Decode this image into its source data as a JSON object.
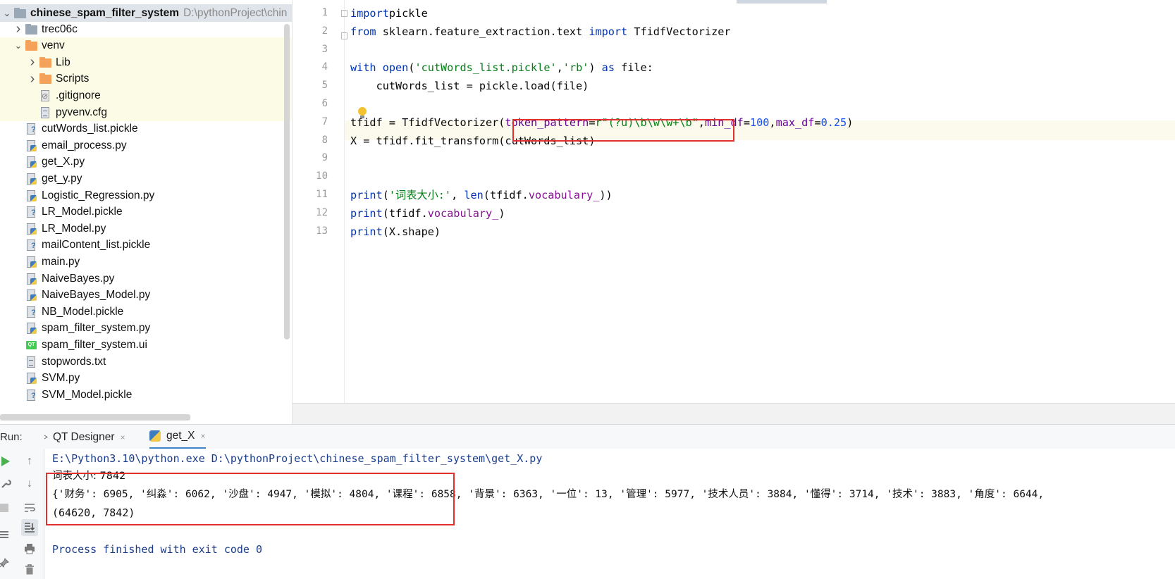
{
  "project_tree": {
    "root": {
      "name": "chinese_spam_filter_system",
      "path": "D:\\pythonProject\\chin"
    },
    "items": [
      {
        "label": "trec06c",
        "type": "folder-grey",
        "depth": 1,
        "chevron": "right"
      },
      {
        "label": "venv",
        "type": "folder-orange",
        "depth": 1,
        "chevron": "down"
      },
      {
        "label": "Lib",
        "type": "folder-orange",
        "depth": 2,
        "chevron": "right"
      },
      {
        "label": "Scripts",
        "type": "folder-orange",
        "depth": 2,
        "chevron": "right"
      },
      {
        "label": ".gitignore",
        "type": "gitignore",
        "depth": 2,
        "chevron": ""
      },
      {
        "label": "pyvenv.cfg",
        "type": "text",
        "depth": 2,
        "chevron": ""
      },
      {
        "label": "cutWords_list.pickle",
        "type": "pickle",
        "depth": 1,
        "chevron": ""
      },
      {
        "label": "email_process.py",
        "type": "python",
        "depth": 1,
        "chevron": ""
      },
      {
        "label": "get_X.py",
        "type": "python",
        "depth": 1,
        "chevron": ""
      },
      {
        "label": "get_y.py",
        "type": "python",
        "depth": 1,
        "chevron": ""
      },
      {
        "label": "Logistic_Regression.py",
        "type": "python",
        "depth": 1,
        "chevron": ""
      },
      {
        "label": "LR_Model.pickle",
        "type": "pickle",
        "depth": 1,
        "chevron": ""
      },
      {
        "label": "LR_Model.py",
        "type": "python",
        "depth": 1,
        "chevron": ""
      },
      {
        "label": "mailContent_list.pickle",
        "type": "pickle",
        "depth": 1,
        "chevron": ""
      },
      {
        "label": "main.py",
        "type": "python",
        "depth": 1,
        "chevron": ""
      },
      {
        "label": "NaiveBayes.py",
        "type": "python",
        "depth": 1,
        "chevron": ""
      },
      {
        "label": "NaiveBayes_Model.py",
        "type": "python",
        "depth": 1,
        "chevron": ""
      },
      {
        "label": "NB_Model.pickle",
        "type": "pickle",
        "depth": 1,
        "chevron": ""
      },
      {
        "label": "spam_filter_system.py",
        "type": "python",
        "depth": 1,
        "chevron": ""
      },
      {
        "label": "spam_filter_system.ui",
        "type": "qt-ui",
        "depth": 1,
        "chevron": ""
      },
      {
        "label": "stopwords.txt",
        "type": "text",
        "depth": 1,
        "chevron": ""
      },
      {
        "label": "SVM.py",
        "type": "python",
        "depth": 1,
        "chevron": ""
      },
      {
        "label": "SVM_Model.pickle",
        "type": "pickle",
        "depth": 1,
        "chevron": ""
      }
    ]
  },
  "editor": {
    "line_numbers": [
      "1",
      "2",
      "3",
      "4",
      "5",
      "6",
      "7",
      "8",
      "9",
      "10",
      "11",
      "12",
      "13"
    ],
    "lines": [
      {
        "spans": [
          [
            "kw",
            "import"
          ],
          [
            "",
            "pickle"
          ]
        ]
      },
      {
        "spans": [
          [
            "kw",
            "from"
          ],
          [
            "",
            " sklearn.feature_extraction.text "
          ],
          [
            "kw",
            "import"
          ],
          [
            "",
            " TfidfVectorizer"
          ]
        ]
      },
      {
        "spans": []
      },
      {
        "spans": [
          [
            "kw",
            "with"
          ],
          [
            "",
            " "
          ],
          [
            "kw",
            "open"
          ],
          [
            "",
            "("
          ],
          [
            "str",
            "'cutWords_list.pickle'"
          ],
          [
            "",
            ","
          ],
          [
            "str",
            "'rb'"
          ],
          [
            "",
            ") "
          ],
          [
            "kw",
            "as"
          ],
          [
            "",
            " file:"
          ]
        ]
      },
      {
        "spans": [
          [
            "",
            "    cutWords_list = pickle.load(file)"
          ]
        ]
      },
      {
        "spans": []
      },
      {
        "spans": [
          [
            "",
            "tfidf = TfidfVectorizer("
          ],
          [
            "prm",
            "token_pattern"
          ],
          [
            "",
            "="
          ],
          [
            "str",
            "r\"(?u)\\b\\w\\w+\\b\""
          ],
          [
            "",
            ","
          ],
          [
            "prm",
            "min_df"
          ],
          [
            "",
            "="
          ],
          [
            "num",
            "100"
          ],
          [
            "",
            ","
          ],
          [
            "prm",
            "max_df"
          ],
          [
            "",
            "="
          ],
          [
            "num",
            "0.25"
          ],
          [
            "",
            ")"
          ]
        ]
      },
      {
        "spans": [
          [
            "",
            "X = tfidf.fit_transform(cutWords_list)"
          ]
        ]
      },
      {
        "spans": []
      },
      {
        "spans": []
      },
      {
        "spans": [
          [
            "kw",
            "print"
          ],
          [
            "",
            "("
          ],
          [
            "str",
            "'词表大小:'"
          ],
          [
            "",
            ", "
          ],
          [
            "kw",
            "len"
          ],
          [
            "",
            "(tfidf."
          ],
          [
            "fld",
            "vocabulary_"
          ],
          [
            "",
            "))"
          ]
        ]
      },
      {
        "spans": [
          [
            "kw",
            "print"
          ],
          [
            "",
            "(tfidf."
          ],
          [
            "fld",
            "vocabulary_"
          ],
          [
            "",
            ")"
          ]
        ]
      },
      {
        "spans": [
          [
            "kw",
            "print"
          ],
          [
            "",
            "(X.shape)"
          ]
        ]
      }
    ]
  },
  "run_panel": {
    "label": "Run:",
    "tabs": [
      {
        "label": "QT Designer",
        "close": "×"
      },
      {
        "label": "get_X",
        "close": "×"
      }
    ],
    "console": {
      "command": "E:\\Python3.10\\python.exe D:\\pythonProject\\chinese_spam_filter_system\\get_X.py",
      "vocab_size": "词表大小: 7842",
      "vocab_dict": "{'财务': 6905, '纠淼': 6062, '沙盘': 4947, '模拟': 4804, '课程': 6858, '背景': 6363, '一位': 13, '管理': 5977, '技术人员': 3884, '懂得': 3714, '技术': 3883, '角度': 6644,",
      "shape": "(64620, 7842)",
      "finished": "Process finished with exit code 0"
    }
  },
  "icons": {
    "run": "run-icon",
    "wrench": "wrench-icon",
    "stop": "stop-icon",
    "layout": "layout-icon",
    "pin": "pin-icon",
    "up": "arrow-up-icon",
    "down": "arrow-down-icon",
    "softwrap": "soft-wrap-icon",
    "scroll_end": "scroll-to-end-icon",
    "print": "print-icon",
    "trash": "trash-icon",
    "bulb": "lightbulb-icon"
  },
  "colors": {
    "keyword": "#0033b3",
    "string": "#067d17",
    "number": "#1750eb",
    "param": "#660099",
    "highlight_box": "#e03030",
    "console_cmd": "#1a3c8c",
    "tree_highlight": "#fbfbe6"
  }
}
